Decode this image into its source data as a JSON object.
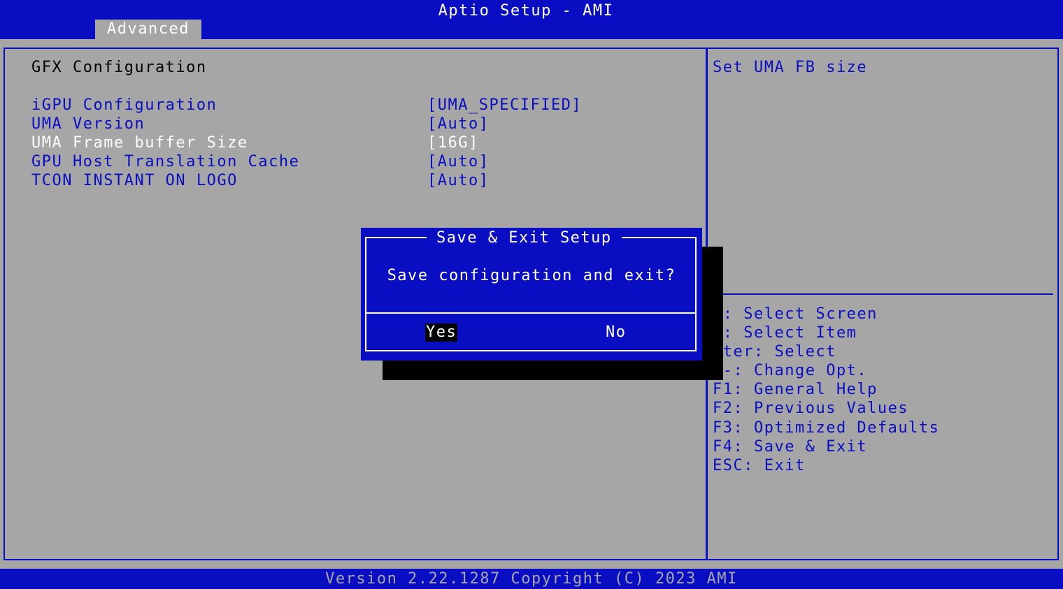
{
  "header": {
    "title": "Aptio Setup - AMI",
    "active_tab": "Advanced"
  },
  "main": {
    "section_title": "GFX Configuration",
    "items": [
      {
        "label": "iGPU Configuration",
        "value": "[UMA_SPECIFIED]"
      },
      {
        "label": "UMA Version",
        "value": "[Auto]"
      },
      {
        "label": "UMA Frame buffer Size",
        "value": "[16G]"
      },
      {
        "label": "GPU Host Translation Cache",
        "value": "[Auto]"
      },
      {
        "label": "TCON INSTANT ON LOGO",
        "value": "[Auto]"
      }
    ]
  },
  "help": {
    "text": "Set UMA FB size",
    "keys": [
      "←: Select Screen",
      "↓: Select Item",
      "nter: Select",
      "/-: Change Opt.",
      "F1: General Help",
      "F2: Previous Values",
      "F3: Optimized Defaults",
      "F4: Save & Exit",
      "ESC: Exit"
    ]
  },
  "dialog": {
    "title": "Save & Exit Setup",
    "message": "Save configuration and exit?",
    "yes_label": "Yes",
    "no_label": "No"
  },
  "footer": {
    "version": "Version 2.22.1287 Copyright (C) 2023 AMI"
  },
  "colors": {
    "blue": "#0a0ec2",
    "gray": "#a6a6a6",
    "white": "#ffffff",
    "black": "#000000"
  }
}
